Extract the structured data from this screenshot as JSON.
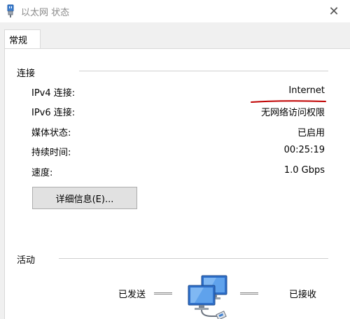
{
  "window": {
    "title": "以太网 状态",
    "close_glyph": "✕"
  },
  "tabs": [
    {
      "label": "常规",
      "active": true
    }
  ],
  "connection": {
    "group_title": "连接",
    "rows": [
      {
        "label": "IPv4 连接:",
        "value": "Internet"
      },
      {
        "label": "IPv6 连接:",
        "value": "无网络访问权限"
      },
      {
        "label": "媒体状态:",
        "value": "已启用"
      },
      {
        "label": "持续时间:",
        "value": "00:25:19"
      },
      {
        "label": "速度:",
        "value": "1.0 Gbps"
      }
    ],
    "details_button": "详细信息(E)..."
  },
  "activity": {
    "group_title": "活动",
    "sent_label": "已发送",
    "received_label": "已接收"
  },
  "colors": {
    "annotation": "#c00000",
    "title_text": "#8a8a8a"
  },
  "icons": {
    "title": "ethernet-adapter-icon",
    "activity": "network-computers-icon"
  }
}
